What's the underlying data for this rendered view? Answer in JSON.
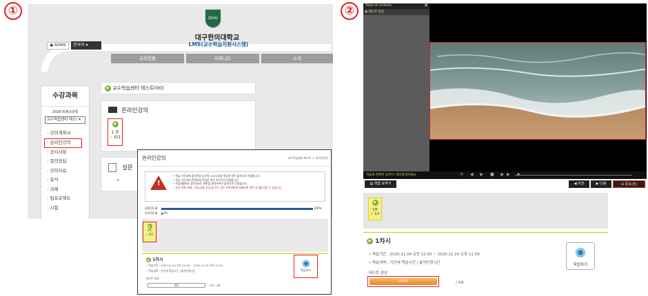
{
  "labels": {
    "one": "①",
    "two": "②"
  },
  "panel1": {
    "logo_text": "DHU",
    "university": "대구한의대학교",
    "lms_title": "LMS(교수학습지원시스템)",
    "admin_label": "ADMIN",
    "language": "한국어",
    "menu": [
      "교육현황",
      "커뮤니티",
      "소개"
    ],
    "sidebar": {
      "title": "수강과목",
      "term": "2020-비정규과목",
      "course_select": "교수학습센터 테스!",
      "items": [
        "강의계획서",
        "온라인강의",
        "공지사항",
        "질의응답",
        "강의자료",
        "출석",
        "과제",
        "팀프로젝트",
        "시험"
      ]
    },
    "breadcrumb": "교수학습센터 테스트(00)",
    "section_title": "온라인강의",
    "week": "1 주",
    "week_progress": "0/1",
    "survey_title": "설문",
    "survey_sub": "ㄷ"
  },
  "overlay": {
    "title": "온라인강의",
    "breadcrumb": "교수학습센터 테스트 > 온라인강의",
    "notice": [
      "학습 기간내에 출석인정 시간의 100%이상 학습한 경우 출석으로 인정됩니다.",
      "학습 기간내에 콘텐츠에 학습한 경우 지각으로 인정됩니다.",
      "학습현황에서 출석(완료) 버튼을 클릭하여야 출석으로 인정됩니다.",
      "무단 복제, 배포, 전송(공중 송신)을 하는 경우 저작권법에 위배되며 법적 조치를 받을 수 있습니다."
    ],
    "progress_labels": [
      "권장진도율",
      "나의진도율"
    ],
    "progress_values": [
      "100%",
      "0%"
    ],
    "week": "1주",
    "week_progress": "0/1",
    "chapter": "1차시",
    "period": "학습기간 : 2020.11.04 오전 12:00 ~ 2020.11.05 오후 11:59",
    "record": "학습내역 : 기간내 학습시간 / 출석인정시간",
    "item_name": "테스트 영상",
    "bar_value": "0%",
    "count": "0초 / 4초",
    "study_button": "학습하기"
  },
  "panel2": {
    "toc_title": "Table of contents",
    "toc_item": "테스트 영상",
    "control_msg": "학습해 완벽한 멈추다! 매끄럽게하세요",
    "buttons": {
      "close": "학습 요약기",
      "prev": "이전",
      "next": "다음",
      "complete": "종료(출)"
    },
    "week": "1주",
    "week_progress": "1/1",
    "chapter": "1차시",
    "period": "학습기간 : 2020.11.04 오전 12:00 ~ 2020.11.20 오후 11:59",
    "record": "학습내역 : 기간내 학습시간 / 출석인정시간",
    "item_name": "테스트 영상",
    "bar_value": "100%",
    "count": "/ 4초",
    "study_button": "학습하기"
  }
}
